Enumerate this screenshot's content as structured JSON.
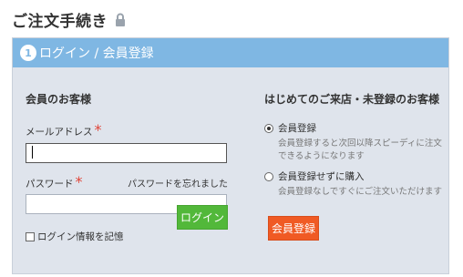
{
  "page": {
    "title": "ご注文手続き"
  },
  "step": {
    "number": "1",
    "title": "ログイン / 会員登録"
  },
  "member": {
    "heading": "会員のお客様",
    "email_label": "メールアドレス",
    "required_mark": "*",
    "password_label": "パスワード",
    "forgot_link": "パスワードを忘れました",
    "remember_label": "ログイン情報を記憶",
    "login_button": "ログイン",
    "email_value": "",
    "password_value": ""
  },
  "guest": {
    "heading": "はじめてのご来店・未登録のお客様",
    "options": [
      {
        "label": "会員登録",
        "description": "会員登録すると次回以降スピーディに注文できるようになります",
        "selected": true
      },
      {
        "label": "会員登録せずに購入",
        "description": "会員登録なしですぐにご注文いただけます",
        "selected": false
      }
    ],
    "register_button": "会員登録"
  },
  "icons": {
    "lock": "lock-icon"
  },
  "colors": {
    "header_blue": "#7fb7e3",
    "panel_bg": "#dfe4ec",
    "login_green": "#52b83a",
    "register_orange": "#f05a24",
    "required_red": "#e0463a"
  }
}
